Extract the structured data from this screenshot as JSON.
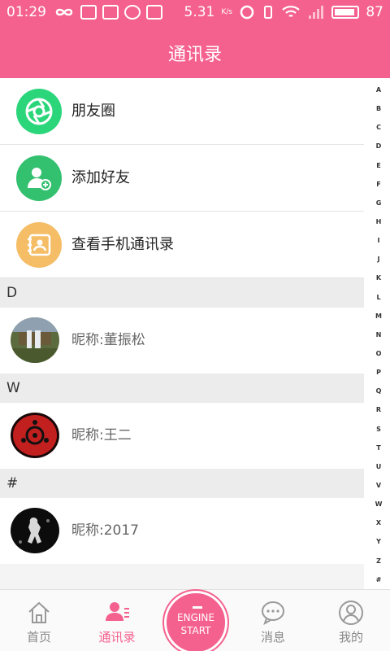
{
  "status_bar": {
    "time": "01:29",
    "network_speed": "5.31",
    "speed_unit": "K/s",
    "battery": "87"
  },
  "header": {
    "title": "通讯录"
  },
  "functions": [
    {
      "label": "朋友圈",
      "icon": "camera-shutter-icon",
      "color": "#2bd67b"
    },
    {
      "label": "添加好友",
      "icon": "add-person-icon",
      "color": "#33c06f"
    },
    {
      "label": "查看手机通讯录",
      "icon": "address-book-icon",
      "color": "#f4bd66"
    }
  ],
  "sections": [
    {
      "letter": "D",
      "contacts": [
        {
          "name": "昵称:董振松",
          "avatar": "waterfall-photo"
        }
      ]
    },
    {
      "letter": "W",
      "contacts": [
        {
          "name": "昵称:王二",
          "avatar": "red-sharingan"
        }
      ]
    },
    {
      "letter": "#",
      "contacts": [
        {
          "name": "昵称:2017",
          "avatar": "dark-figure"
        }
      ]
    }
  ],
  "index_letters": [
    "A",
    "B",
    "C",
    "D",
    "E",
    "F",
    "G",
    "H",
    "I",
    "J",
    "K",
    "L",
    "M",
    "N",
    "O",
    "P",
    "Q",
    "R",
    "S",
    "T",
    "U",
    "V",
    "W",
    "X",
    "Y",
    "Z",
    "#"
  ],
  "tabs": [
    {
      "label": "首页",
      "icon": "home-icon"
    },
    {
      "label": "通讯录",
      "icon": "contacts-icon",
      "active": true
    },
    {
      "center_line1": "ENGINE",
      "center_line2": "START"
    },
    {
      "label": "消息",
      "icon": "message-icon"
    },
    {
      "label": "我的",
      "icon": "profile-icon"
    }
  ],
  "colors": {
    "accent": "#f5618f",
    "section_bg": "#ececec"
  }
}
